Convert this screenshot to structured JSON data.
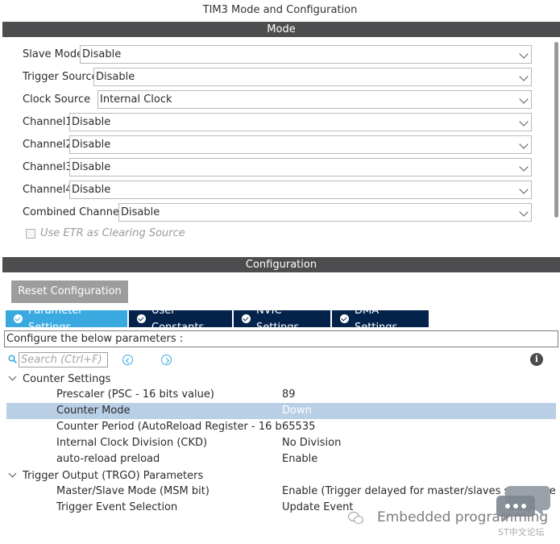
{
  "window": {
    "title": "TIM3 Mode and Configuration"
  },
  "mode": {
    "header": "Mode",
    "rows": [
      {
        "label": "Slave Mode",
        "value": "Disable"
      },
      {
        "label": "Trigger Source",
        "value": "Disable"
      },
      {
        "label": "Clock Source",
        "value": "Internal Clock"
      },
      {
        "label": "Channel1",
        "value": "Disable"
      },
      {
        "label": "Channel2",
        "value": "Disable"
      },
      {
        "label": "Channel3",
        "value": "Disable"
      },
      {
        "label": "Channel4",
        "value": "Disable"
      },
      {
        "label": "Combined Channels",
        "value": "Disable"
      }
    ],
    "etr_checkbox": {
      "label": "Use ETR as Clearing Source",
      "checked": false
    }
  },
  "configuration": {
    "header": "Configuration",
    "reset_button": "Reset Configuration",
    "tabs": [
      {
        "label": "Parameter Settings",
        "active": true
      },
      {
        "label": "User Constants",
        "active": false
      },
      {
        "label": "NVIC Settings",
        "active": false
      },
      {
        "label": "DMA Settings",
        "active": false
      }
    ],
    "instructions": "Configure the below parameters :",
    "search": {
      "placeholder": "Search (Ctrl+F)"
    },
    "groups": [
      {
        "name": "Counter Settings",
        "params": [
          {
            "name": "Prescaler (PSC - 16 bits value)",
            "value": "89"
          },
          {
            "name": "Counter Mode",
            "value": "Down"
          },
          {
            "name": "Counter Period (AutoReload Register - 16 bits...",
            "value": "65535"
          },
          {
            "name": "Internal Clock Division (CKD)",
            "value": "No Division"
          },
          {
            "name": "auto-reload preload",
            "value": "Enable"
          }
        ]
      },
      {
        "name": "Trigger Output (TRGO) Parameters",
        "params": [
          {
            "name": "Master/Slave Mode (MSM bit)",
            "value": "Enable (Trigger delayed for master/slaves simultaneous ..."
          },
          {
            "name": "Trigger Event Selection",
            "value": "Update Event"
          }
        ]
      }
    ]
  },
  "watermark": {
    "text": "Embedded programming",
    "st_text": "ST中文论坛"
  },
  "colors": {
    "section_bar": "#4d4d4f",
    "tab_active": "#39a9e0",
    "tab_inactive": "#03234b",
    "selected_row": "#b9cfe5"
  }
}
